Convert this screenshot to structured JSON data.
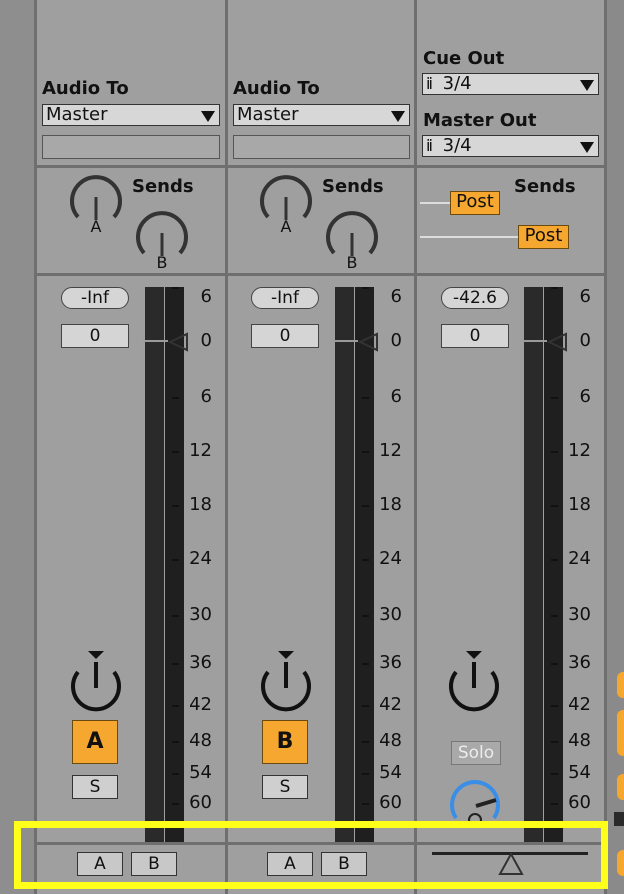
{
  "tracks": [
    {
      "id": "track1",
      "output_label": "Audio To",
      "output_value": "Master",
      "sends_label": "Sends",
      "send_knobs": [
        "A",
        "B"
      ],
      "peak_display": "-Inf",
      "volume_value": "0",
      "activator_label": "A",
      "solo_label": "S",
      "crossfade_buttons": [
        "A",
        "B"
      ]
    },
    {
      "id": "track2",
      "output_label": "Audio To",
      "output_value": "Master",
      "sends_label": "Sends",
      "send_knobs": [
        "A",
        "B"
      ],
      "peak_display": "-Inf",
      "volume_value": "0",
      "activator_label": "B",
      "solo_label": "S",
      "crossfade_buttons": [
        "A",
        "B"
      ]
    }
  ],
  "master": {
    "cue_out_label": "Cue Out",
    "cue_out_value": "3/4",
    "master_out_label": "Master Out",
    "master_out_value": "3/4",
    "sends_label": "Sends",
    "post_buttons": [
      "Post",
      "Post"
    ],
    "peak_display": "-42.6",
    "volume_value": "0",
    "solo_label": "Solo"
  },
  "meter_scale": [
    "6",
    "0",
    "6",
    "12",
    "18",
    "24",
    "30",
    "36",
    "42",
    "48",
    "54",
    "60"
  ],
  "colors": {
    "accent_orange": "#f6a72f",
    "highlight_yellow": "#ffff1a",
    "cue_knob_blue": "#3a8ee6",
    "panel_gray": "#9f9f9f"
  },
  "icons": {
    "output_dropdown_arrow": "triangle-down",
    "io_channel": "stereo-pair-icon",
    "crossfader_handle": "triangle-up"
  }
}
